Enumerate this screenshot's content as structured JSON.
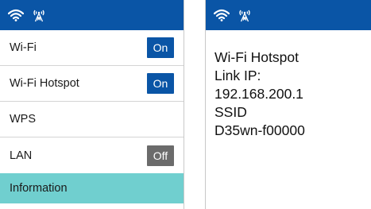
{
  "colors": {
    "statusbar": "#0a55a6",
    "toggle_on": "#0a55a6",
    "toggle_off": "#6b6b6b",
    "selected_item": "#70cfcf"
  },
  "statusbar": {
    "icons": [
      "wifi-icon",
      "hotspot-icon"
    ]
  },
  "menu": {
    "items": [
      {
        "label": "Wi-Fi",
        "toggle": "On"
      },
      {
        "label": "Wi-Fi Hotspot",
        "toggle": "On"
      },
      {
        "label": "WPS"
      },
      {
        "label": "LAN",
        "toggle": "Off"
      },
      {
        "label": "Information",
        "selected": true
      }
    ]
  },
  "info": {
    "lines": [
      "Wi-Fi Hotspot",
      "Link IP:",
      "192.168.200.1",
      "SSID",
      "D35wn-f00000"
    ]
  }
}
